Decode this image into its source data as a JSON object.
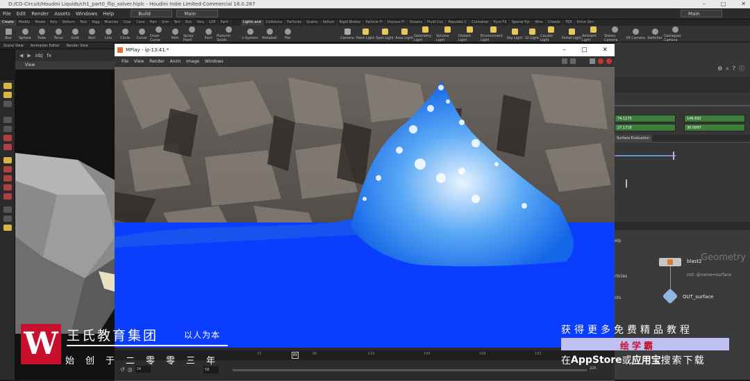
{
  "window": {
    "title": "D:/CG-Circuit/Houdini Liquids/ch1_part0_flip_solver.hiplc - Houdini Indie Limited-Commercial 18.0.287",
    "controls": [
      "–",
      "□",
      "✕"
    ]
  },
  "menubar": {
    "items": [
      "File",
      "Edit",
      "Render",
      "Assets",
      "Windows",
      "Help"
    ],
    "desktop": "Build",
    "context": "Main",
    "right_desktop": "Main"
  },
  "shelf": {
    "tabs": [
      "Create",
      "Modify",
      "Model",
      "Poly",
      "Deform",
      "Text",
      "Rigg",
      "Muscles",
      "Char",
      "Cons",
      "Hair",
      "Grm",
      "Terr",
      "Sim",
      "Volu",
      "LOP",
      "Parti"
    ],
    "tabs_right": [
      "Lights and",
      "Collisions",
      "Particles",
      "Grains",
      "Vellum",
      "Rigid Bodies",
      "Particle Fl",
      "Viscous Fl",
      "Oceans",
      "Fluid Con",
      "Populate C",
      "Container",
      "Pyro FX",
      "Sparse Pyr",
      "Wire",
      "Crowds",
      "TER",
      "Drive Sim"
    ],
    "tools": [
      "Box",
      "Sphere",
      "Tube",
      "Torus",
      "Grid",
      "Null",
      "Line",
      "Circle",
      "Curve",
      "Draw Curve",
      "Path",
      "Spray Paint",
      "Font",
      "Platonic Solids",
      "L-System",
      "Metaball",
      "File"
    ],
    "light_tools": [
      "Camera",
      "Point Light",
      "Spot Light",
      "Area Light",
      "Geometry Light",
      "Volume Light",
      "Distant Light",
      "Environment Light",
      "Sky Light",
      "GI Light",
      "Caustic Light",
      "Portal Light",
      "Ambient Light",
      "Stereo Camera",
      "VR Camera",
      "Switcher",
      "Gamepad Camera"
    ]
  },
  "left": {
    "tabs": [
      "Scene View",
      "Animation Editor",
      "Render View"
    ],
    "path": [
      "obj",
      "fx"
    ],
    "view_label": "View"
  },
  "mplay": {
    "title": "MPlay - ip-13:41:*",
    "menu": [
      "File",
      "View",
      "Render",
      "Anim",
      "Image",
      "Windows"
    ],
    "frame": "85",
    "start": "24",
    "end": "225",
    "step": "58",
    "ticks": [
      "72",
      "96",
      "120",
      "144",
      "168",
      "192"
    ]
  },
  "right": {
    "values": [
      "74.1175",
      "146.692",
      "27.1718",
      "30.0997"
    ],
    "tab": "Surface Evaluation",
    "node_title": "Geometry",
    "help_label": "elp",
    "nodes": [
      {
        "name": "blast2",
        "sub": "not: @name=surface"
      },
      {
        "name": "OUT_surface",
        "sub": ""
      }
    ],
    "side_labels": [
      "rticles",
      "nts"
    ]
  },
  "watermark": {
    "logo": "W",
    "title": "王氏教育集团",
    "slogan": "以人为本",
    "sub": "始创于二零零三年",
    "ad_line1": "获得更多免费精品教程",
    "ad_name": "绘学霸",
    "ad_line2_a": "在",
    "ad_line2_b": "AppStore",
    "ad_line2_c": "或",
    "ad_line2_d": "应用宝",
    "ad_line2_e": "搜索下载"
  }
}
